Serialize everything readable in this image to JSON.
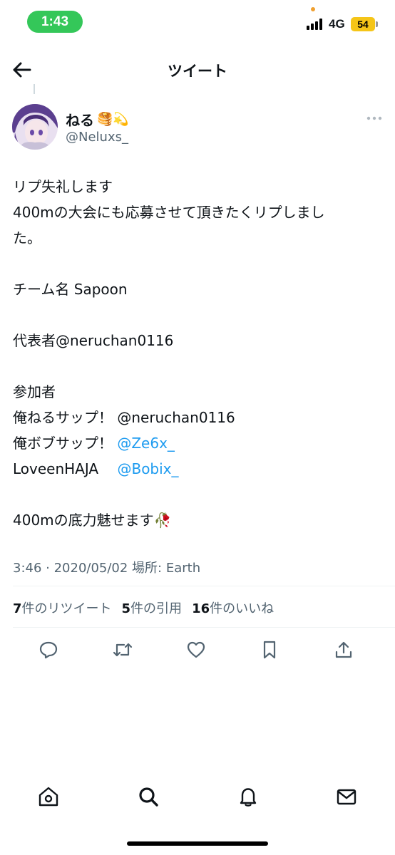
{
  "status_bar": {
    "time": "1:43",
    "network": "4G",
    "battery": "54"
  },
  "header": {
    "title": "ツイート",
    "back_icon": "arrow-left-icon"
  },
  "author": {
    "display_name": "ねる",
    "name_emojis": "🥞💫",
    "handle": "@Neluxs_"
  },
  "tweet": {
    "lines": [
      {
        "text": "リプ失礼します"
      },
      {
        "text": "400mの大会にも応募させて頂きたくリプしまし"
      },
      {
        "text": "た。"
      },
      {
        "text": ""
      },
      {
        "text": "チーム名 Sapoon"
      },
      {
        "text": ""
      },
      {
        "text": "代表者@neruchan0116"
      },
      {
        "text": ""
      },
      {
        "text": "参加者"
      },
      {
        "text": "俺ねるサップ！ @neruchan0116"
      },
      {
        "prefix": "俺ボブサップ！ ",
        "mention": "@Ze6x_"
      },
      {
        "prefix": "LoveenHAJA　 ",
        "mention": "@Bobix_"
      },
      {
        "text": ""
      },
      {
        "text": "400mの底力魅せます🥀"
      }
    ],
    "timestamp": "3:46 · 2020/05/02 場所: Earth"
  },
  "stats": {
    "retweets_count": "7",
    "retweets_label": "件のリツイート",
    "quotes_count": "5",
    "quotes_label": "件の引用",
    "likes_count": "16",
    "likes_label": "件のいいね"
  },
  "actions": [
    "reply-icon",
    "retweet-icon",
    "like-icon",
    "bookmark-icon",
    "share-icon"
  ],
  "bottom_nav": [
    "home-icon",
    "search-icon",
    "notifications-icon",
    "messages-icon"
  ],
  "colors": {
    "accent": "#1d9bf0",
    "secondary_text": "#536471",
    "primary_text": "#0f1419",
    "status_pill": "#34c759",
    "battery": "#f5c518"
  }
}
